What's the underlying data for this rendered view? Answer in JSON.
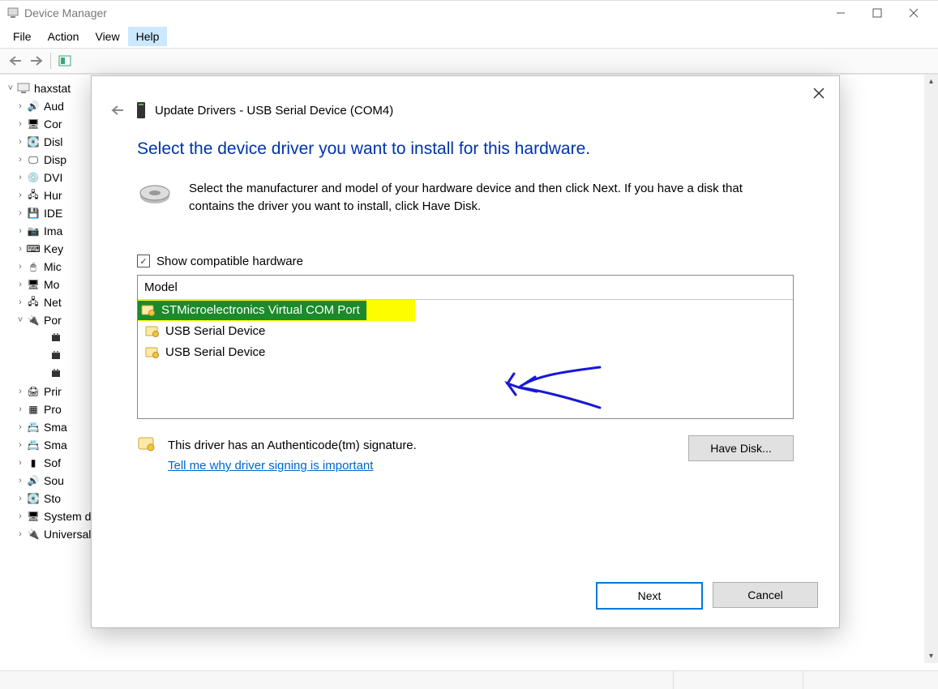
{
  "window": {
    "title": "Device Manager",
    "menus": [
      "File",
      "Action",
      "View",
      "Help"
    ],
    "menu_highlight_index": 3
  },
  "tree": {
    "root": "haxstat",
    "items": [
      {
        "label": "Aud",
        "exp": ">"
      },
      {
        "label": "Cor",
        "exp": ">"
      },
      {
        "label": "Disl",
        "exp": ">"
      },
      {
        "label": "Disp",
        "exp": ">"
      },
      {
        "label": "DVI",
        "exp": ">"
      },
      {
        "label": "Hur",
        "exp": ">"
      },
      {
        "label": "IDE",
        "exp": ">"
      },
      {
        "label": "Ima",
        "exp": ">"
      },
      {
        "label": "Key",
        "exp": ">"
      },
      {
        "label": "Mic",
        "exp": ">"
      },
      {
        "label": "Mo",
        "exp": ">"
      },
      {
        "label": "Net",
        "exp": ">"
      },
      {
        "label": "Por",
        "exp": "v",
        "children": [
          {
            "label": ""
          },
          {
            "label": ""
          },
          {
            "label": ""
          }
        ]
      },
      {
        "label": "Prir",
        "exp": ">"
      },
      {
        "label": "Pro",
        "exp": ">"
      },
      {
        "label": "Sma",
        "exp": ">"
      },
      {
        "label": "Sma",
        "exp": ">"
      },
      {
        "label": "Sof",
        "exp": ">"
      },
      {
        "label": "Sou",
        "exp": ">"
      },
      {
        "label": "Sto",
        "exp": ">"
      },
      {
        "label": "System devices",
        "exp": ">"
      },
      {
        "label": "Universal Serial Bus controllers",
        "exp": ">"
      }
    ]
  },
  "dialog": {
    "title": "Update Drivers - USB Serial Device (COM4)",
    "heading": "Select the device driver you want to install for this hardware.",
    "instruction": "Select the manufacturer and model of your hardware device and then click Next. If you have a disk that contains the driver you want to install, click Have Disk.",
    "show_compatible_label": "Show compatible hardware",
    "show_compatible_checked": true,
    "list_header": "Model",
    "models": [
      {
        "name": "STMicroelectronics Virtual COM Port",
        "selected": true,
        "highlight": true
      },
      {
        "name": "USB Serial Device",
        "selected": false
      },
      {
        "name": "USB Serial Device",
        "selected": false
      }
    ],
    "signature_text": "This driver has an Authenticode(tm) signature.",
    "signature_link": "Tell me why driver signing is important",
    "have_disk": "Have Disk...",
    "next": "Next",
    "cancel": "Cancel"
  }
}
